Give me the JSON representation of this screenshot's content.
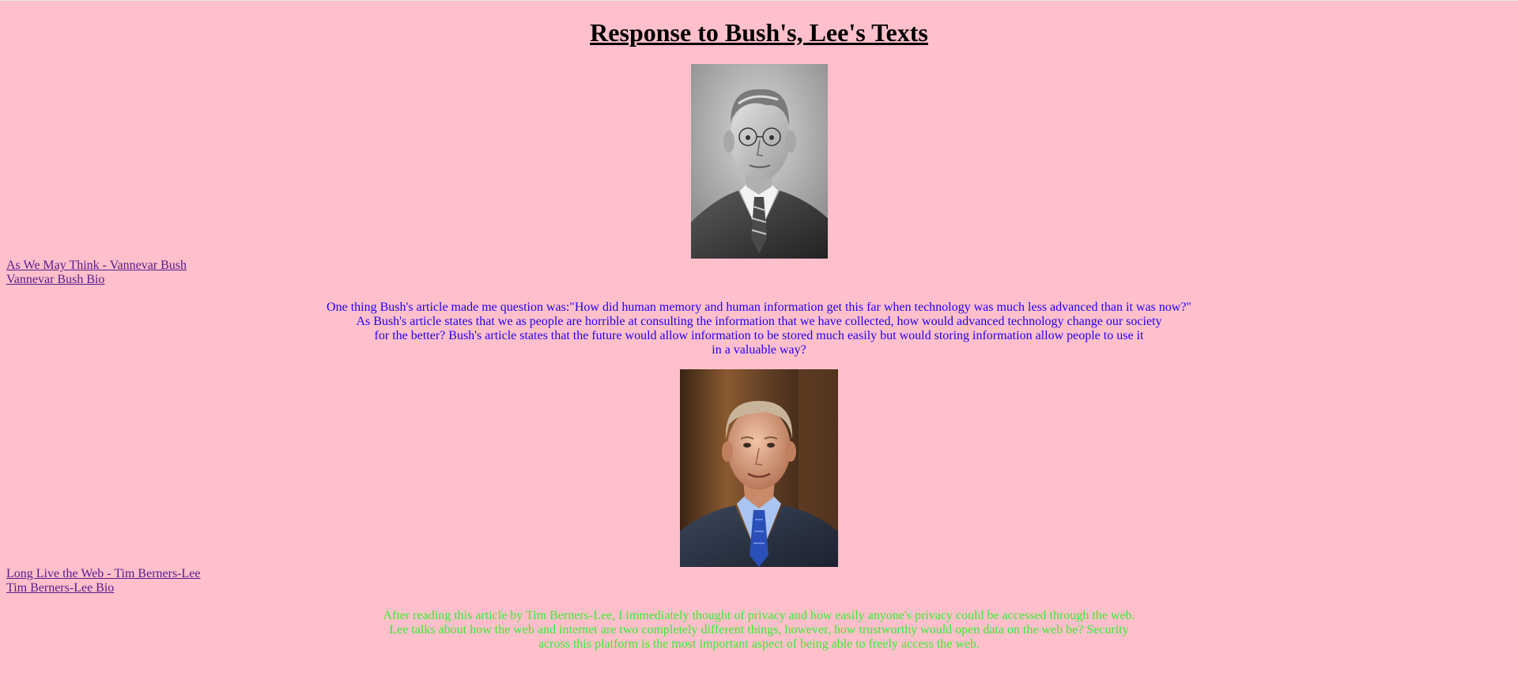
{
  "page": {
    "title": "Response to Bush's, Lee's Texts",
    "background_color": "#ffc0cb"
  },
  "bush": {
    "photo_icon": "vannevar-bush-portrait",
    "links": [
      "As We May Think - Vannevar Bush",
      "Vannevar Bush Bio"
    ],
    "response_color": "#2200ee",
    "response_lines": [
      "One thing Bush's article made me question was:\"How did human memory and human information get this far when technology was much less advanced than it was now?\"",
      "As Bush's article states that we as people are horrible at consulting the information that we have collected, how would advanced technology change our society",
      "for the better? Bush's article states that the future would allow information to be stored much easily but would storing information allow people to use it",
      "in a valuable way?"
    ]
  },
  "lee": {
    "photo_icon": "tim-berners-lee-portrait",
    "links": [
      "Long Live the Web - Tim Berners-Lee",
      "Tim Berners-Lee Bio"
    ],
    "response_color": "#33ee33",
    "response_lines": [
      "After reading this article by Tim Berners-Lee, I immediately thought of privacy and how easily anyone's privacy could be accessed through the web.",
      "Lee talks about how the web and internet are two completely different things, however, how trustworthy would open data on the web be? Security",
      "across this platform is the most important aspect of being able to freely access the web."
    ]
  },
  "link_color": "#551a8b"
}
